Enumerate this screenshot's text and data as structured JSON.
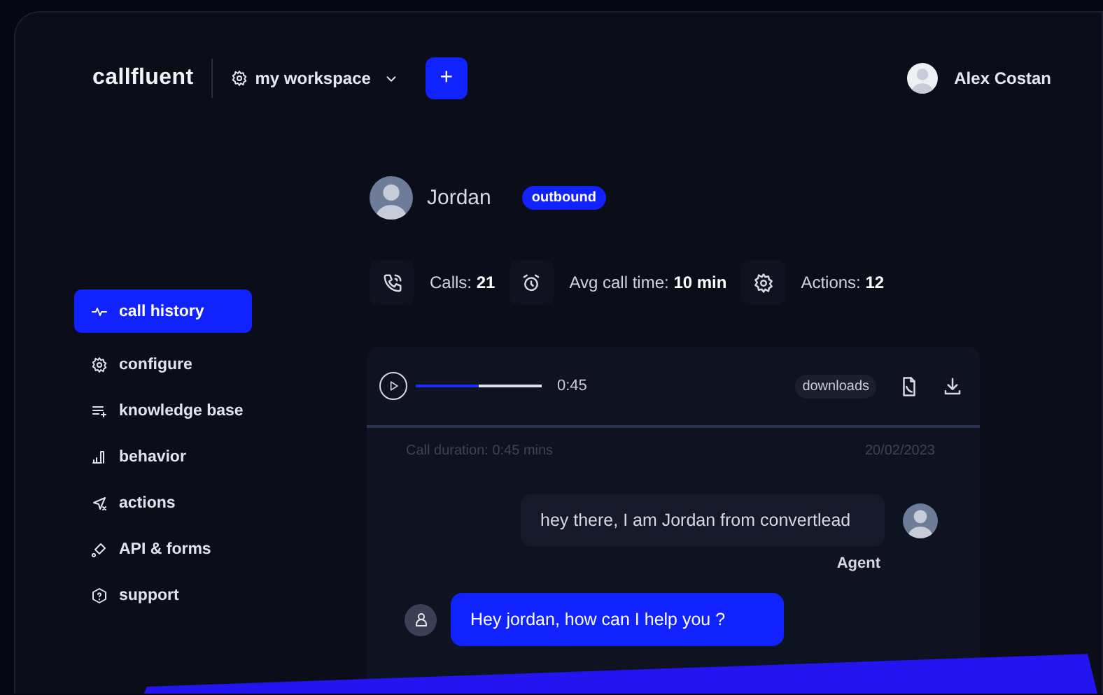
{
  "header": {
    "logo": "callfluent",
    "workspace": "my workspace",
    "add_button": "+",
    "user": "Alex Costan"
  },
  "sidebar": {
    "items": [
      {
        "label": "call history",
        "selected": true
      },
      {
        "label": "configure",
        "selected": false
      },
      {
        "label": "knowledge base",
        "selected": false
      },
      {
        "label": "behavior",
        "selected": false
      },
      {
        "label": "actions",
        "selected": false
      },
      {
        "label": "API & forms",
        "selected": false
      },
      {
        "label": "support",
        "selected": false
      }
    ]
  },
  "contact": {
    "name": "Jordan",
    "tag": "outbound"
  },
  "stats": [
    {
      "label": "Calls:",
      "value": "21"
    },
    {
      "label": "Avg call time:",
      "value": "10 min"
    },
    {
      "label": "Actions:",
      "value": "12"
    }
  ],
  "player": {
    "level": 0.5,
    "time": "0:45",
    "downloads": "downloads"
  },
  "call": {
    "duration": "Call duration: 0:45 mins",
    "date": "20/02/2023"
  },
  "messages": [
    {
      "kind": "agent",
      "text": "hey there, I am Jordan from convertlead",
      "sender": "Agent"
    },
    {
      "kind": "user",
      "text": "Hey jordan, how can I help you ?"
    }
  ]
}
